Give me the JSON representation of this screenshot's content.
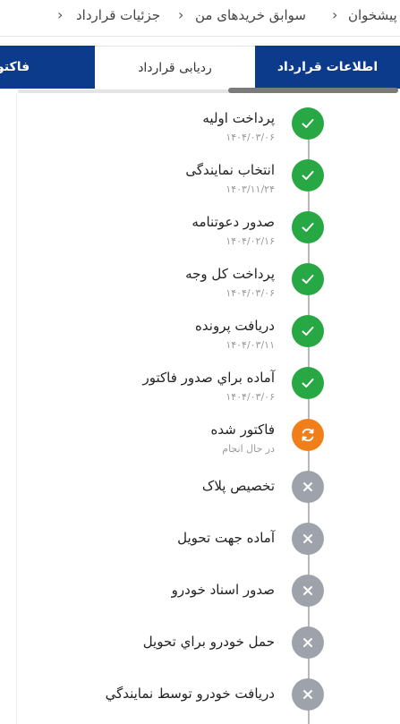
{
  "breadcrumb": {
    "items": [
      "پیشخوان",
      "سوابق خریدهای من",
      "جزئیات قرارداد"
    ]
  },
  "tabs": [
    {
      "label": "اطلاعات قرارداد"
    },
    {
      "label": "ردیابی قرارداد"
    },
    {
      "label": "فاکتور"
    }
  ],
  "colors": {
    "brand": "#0c3b8c",
    "done": "#27a844",
    "in_progress": "#f07f19",
    "pending": "#9ea3ab"
  },
  "steps": [
    {
      "title": "پرداخت اولیه",
      "sub": "۱۴۰۴/۰۳/۰۶",
      "status": "done",
      "icon": "check-icon"
    },
    {
      "title": "انتخاب نمایندگی",
      "sub": "۱۴۰۳/۱۱/۲۴",
      "status": "done",
      "icon": "check-icon"
    },
    {
      "title": "صدور دعوتنامه",
      "sub": "۱۴۰۴/۰۲/۱۶",
      "status": "done",
      "icon": "check-icon"
    },
    {
      "title": "پرداخت کل وجه",
      "sub": "۱۴۰۴/۰۳/۰۶",
      "status": "done",
      "icon": "check-icon"
    },
    {
      "title": "دریافت پرونده",
      "sub": "۱۴۰۴/۰۳/۱۱",
      "status": "done",
      "icon": "check-icon"
    },
    {
      "title": "آماده براي صدور فاکتور",
      "sub": "۱۴۰۴/۰۳/۰۶",
      "status": "done",
      "icon": "check-icon"
    },
    {
      "title": "فاکتور شده",
      "sub": "در حال انجام",
      "status": "in_progress",
      "icon": "sync-icon"
    },
    {
      "title": "تخصیص پلاک",
      "sub": "",
      "status": "pending",
      "icon": "close-icon"
    },
    {
      "title": "آماده جهت تحویل",
      "sub": "",
      "status": "pending",
      "icon": "close-icon"
    },
    {
      "title": "صدور اسناد خودرو",
      "sub": "",
      "status": "pending",
      "icon": "close-icon"
    },
    {
      "title": "حمل خودرو براي تحویل",
      "sub": "",
      "status": "pending",
      "icon": "close-icon"
    },
    {
      "title": "دریافت خودرو توسط نمایندگي",
      "sub": "",
      "status": "pending",
      "icon": "close-icon"
    }
  ]
}
